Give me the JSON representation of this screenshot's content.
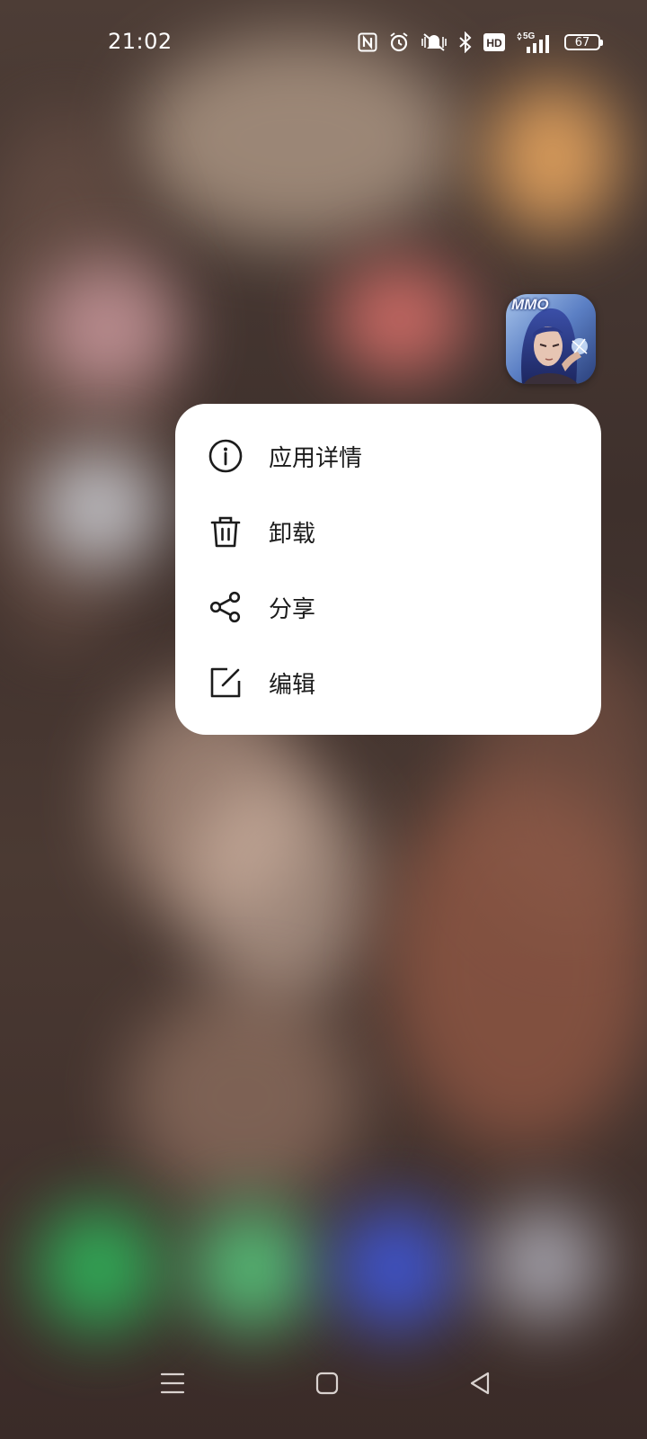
{
  "status_bar": {
    "time": "21:02",
    "network": "5G",
    "hd_label": "HD",
    "battery": "67",
    "icons": [
      "nfc-icon",
      "alarm-icon",
      "vibrate-icon",
      "bluetooth-icon",
      "hd-icon",
      "signal-5g-icon",
      "battery-icon"
    ]
  },
  "app_icon": {
    "label": "MMO"
  },
  "context_menu": {
    "items": [
      {
        "label": "应用详情",
        "icon": "info-icon"
      },
      {
        "label": "卸载",
        "icon": "trash-icon"
      },
      {
        "label": "分享",
        "icon": "share-icon"
      },
      {
        "label": "编辑",
        "icon": "edit-icon"
      }
    ]
  },
  "navigation_bar": {
    "buttons": [
      "menu-icon",
      "home-icon",
      "back-icon"
    ]
  },
  "colors": {
    "menu_background": "#ffffff",
    "menu_text": "#1c1c1c",
    "status_text": "#ffffff"
  }
}
